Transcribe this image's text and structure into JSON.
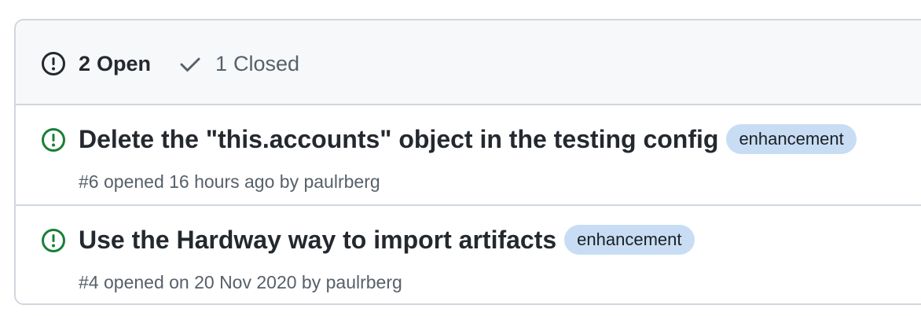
{
  "tabs": {
    "open": {
      "count": "2",
      "label": "Open",
      "icon": "issue-opened-icon"
    },
    "closed": {
      "count": "1",
      "label": "Closed",
      "icon": "check-icon"
    }
  },
  "colors": {
    "open_icon": "#1a7f37",
    "label_bg": "#c8ddf4",
    "border": "#d0d7de",
    "header_bg": "#f6f8fa"
  },
  "issues": [
    {
      "title": "Delete the \"this.accounts\" object in the testing config",
      "label": "enhancement",
      "number": "#6",
      "opened_text": "opened 16 hours ago by",
      "author": "paulrberg"
    },
    {
      "title": "Use the Hardway way to import artifacts",
      "label": "enhancement",
      "number": "#4",
      "opened_text": "opened on 20 Nov 2020 by",
      "author": "paulrberg"
    }
  ]
}
